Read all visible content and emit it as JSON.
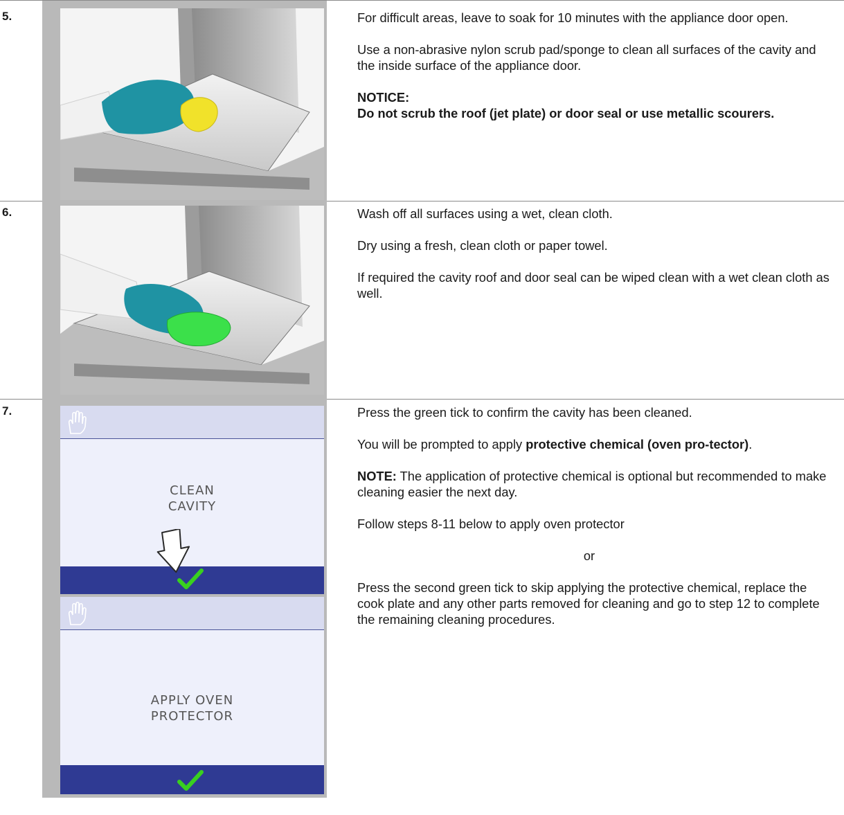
{
  "steps": [
    {
      "number": "5.",
      "paragraphs": {
        "p1": "For difficult areas, leave to soak for 10 minutes with the appliance door open.",
        "p2": "Use a non-abrasive nylon scrub pad/sponge to clean all surfaces of the cavity and the inside surface of the appliance door.",
        "notice_title": "NOTICE:",
        "notice_body": "Do not scrub the roof (jet plate) or door seal or use metallic scourers."
      }
    },
    {
      "number": "6.",
      "paragraphs": {
        "p1": "Wash off all surfaces using a wet, clean cloth.",
        "p2": "Dry using a fresh, clean cloth or paper towel.",
        "p3": "If required the cavity roof and door seal can be wiped clean with a wet clean cloth as well."
      }
    },
    {
      "number": "7.",
      "paragraphs": {
        "p1": "Press the green tick to confirm the cavity has been cleaned.",
        "p2_prefix": "You will be prompted to apply ",
        "p2_bold": "protective chemical (oven pro-tector)",
        "p2_suffix": ".",
        "p3_label": "NOTE:",
        "p3_body": " The application of protective chemical is optional but recommended to make cleaning easier the next day.",
        "p4": "Follow steps 8-11 below to apply oven protector",
        "p5": "or",
        "p6": "Press the second green tick to skip applying the protective chemical, replace the cook plate and any other parts removed for cleaning and go to step 12 to complete the remaining cleaning procedures."
      },
      "screens": [
        {
          "line1": "CLEAN",
          "line2": "CAVITY"
        },
        {
          "line1": "APPLY OVEN",
          "line2": "PROTECTOR"
        }
      ]
    }
  ],
  "colors": {
    "screen_bg": "#eef0fb",
    "screen_header": "#d8dbf0",
    "screen_footer": "#2f3a93",
    "tick_green": "#39d01f",
    "glove_teal": "#1f93a3"
  },
  "icons": [
    "gloved-hand-icon",
    "green-tick-icon",
    "arrow-down-icon"
  ]
}
